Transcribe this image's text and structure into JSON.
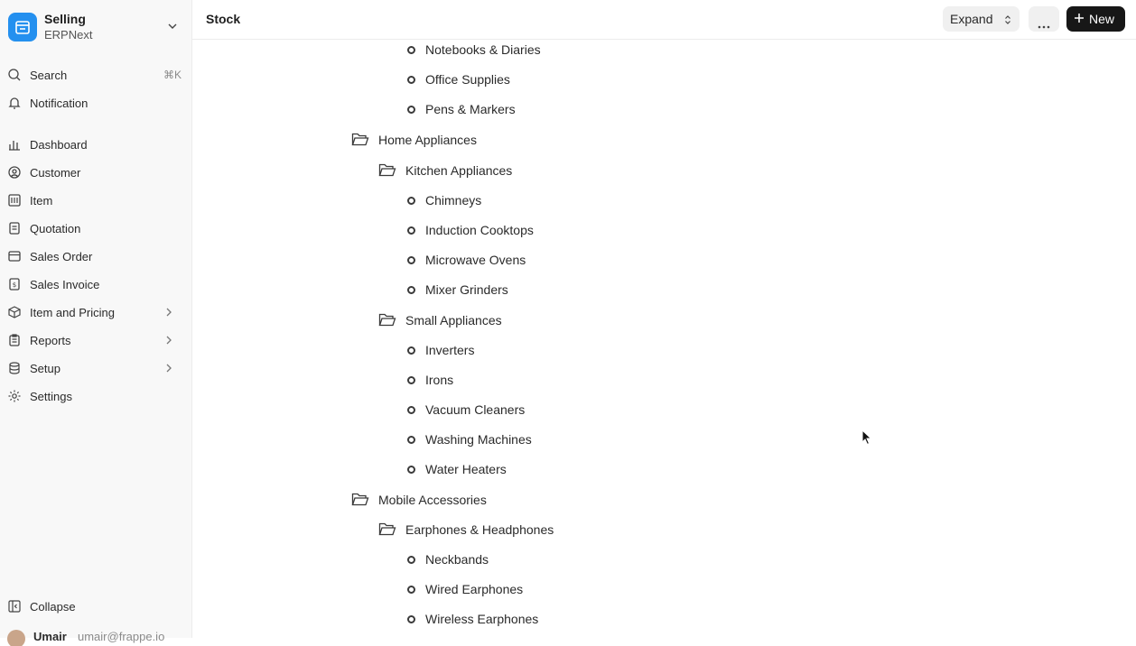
{
  "app": {
    "title": "Selling",
    "subtitle": "ERPNext"
  },
  "sidebar": {
    "search_label": "Search",
    "search_shortcut": "⌘K",
    "notification_label": "Notification",
    "items": [
      {
        "label": "Dashboard"
      },
      {
        "label": "Customer"
      },
      {
        "label": "Item"
      },
      {
        "label": "Quotation"
      },
      {
        "label": "Sales Order"
      },
      {
        "label": "Sales Invoice"
      },
      {
        "label": "Item and Pricing"
      },
      {
        "label": "Reports"
      },
      {
        "label": "Setup"
      },
      {
        "label": "Settings"
      }
    ],
    "collapse_label": "Collapse",
    "user": {
      "name": "Umair",
      "email": "umair@frappe.io"
    }
  },
  "header": {
    "title": "Stock",
    "expand_label": "Expand",
    "new_label": "New"
  },
  "tree": {
    "nodes": [
      {
        "label": "Notebooks & Diaries"
      },
      {
        "label": "Office Supplies"
      },
      {
        "label": "Pens & Markers"
      },
      {
        "label": "Home Appliances"
      },
      {
        "label": "Kitchen Appliances"
      },
      {
        "label": "Chimneys"
      },
      {
        "label": "Induction Cooktops"
      },
      {
        "label": "Microwave Ovens"
      },
      {
        "label": "Mixer Grinders"
      },
      {
        "label": "Small Appliances"
      },
      {
        "label": "Inverters"
      },
      {
        "label": "Irons"
      },
      {
        "label": "Vacuum Cleaners"
      },
      {
        "label": "Washing Machines"
      },
      {
        "label": "Water Heaters"
      },
      {
        "label": "Mobile Accessories"
      },
      {
        "label": "Earphones & Headphones"
      },
      {
        "label": "Neckbands"
      },
      {
        "label": "Wired Earphones"
      },
      {
        "label": "Wireless Earphones"
      }
    ]
  },
  "colors": {
    "accent": "#2490ef",
    "primary_button": "#171717"
  }
}
